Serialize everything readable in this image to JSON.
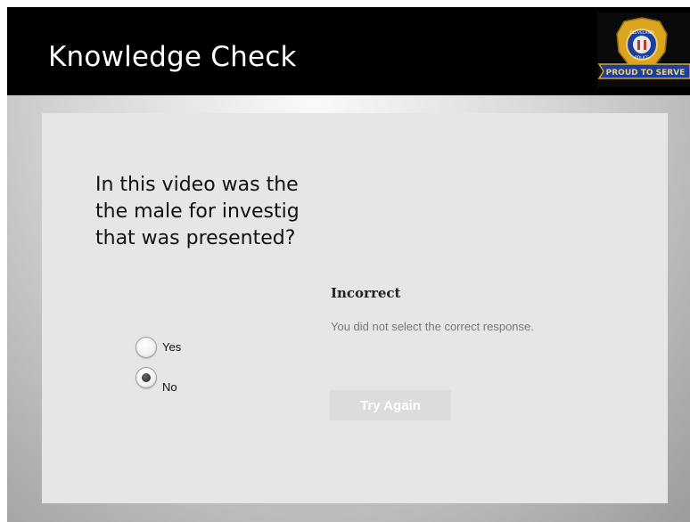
{
  "header": {
    "title": "Knowledge Check",
    "badge": {
      "icon": "police-badge-icon",
      "text_top": "CLEVELAND",
      "text_bottom": "POLICE",
      "banner": "PROUD TO SERVE"
    }
  },
  "question": {
    "lines": [
      "In this video was the",
      "the male for investig",
      "that was presented?"
    ]
  },
  "choices": [
    {
      "label": "Yes",
      "selected": false
    },
    {
      "label": "No",
      "selected": true
    }
  ],
  "feedback": {
    "title": "Incorrect",
    "message": "You did not select the correct response.",
    "button_label": "Try Again"
  },
  "colors": {
    "header_bg": "#000000",
    "panel_bg": "#e6e6e6",
    "button_bg": "#dcdcdc",
    "badge_gold": "#d9a520",
    "banner_blue": "#1a3f9e"
  }
}
